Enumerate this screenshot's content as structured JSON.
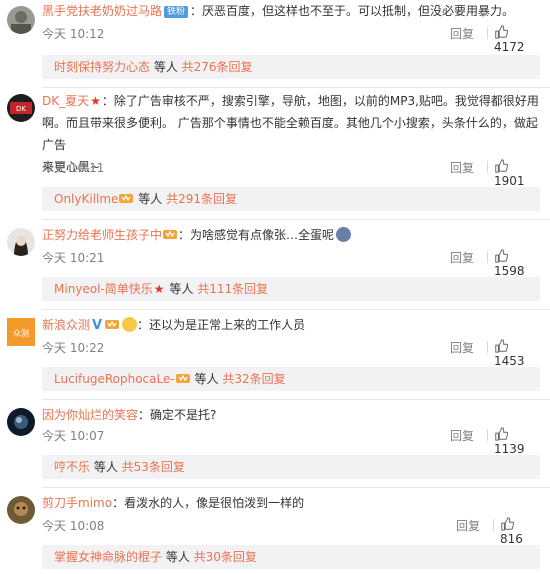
{
  "comments": [
    {
      "username": "黑手党扶老奶奶过马路",
      "badge": "铁粉",
      "text": "：厌恶百度，但这样也不至于。可以抵制，但没必要用暴力。",
      "time": "今天 10:12",
      "reply_label": "回复",
      "likes": "4172",
      "replies": {
        "name": "时刻保持努力心态",
        "mid": " 等人 ",
        "count": "共276条回复"
      }
    },
    {
      "username": "DK_夏天",
      "text_line1": "：除了广告审核不严，搜索引擎，导航，地图，以前的MP3,贴吧。我觉得都很好用",
      "text_line2": "啊。而且带来很多便利。 广告那个事情也不能全赖百度。其他几个小搜索，头条什么的，做起广告",
      "text_line3": "来更心黑~",
      "time": "今天 10:11",
      "reply_label": "回复",
      "likes": "1901",
      "replies": {
        "name": "OnlyKillme",
        "mid": " 等人 ",
        "count": "共291条回复"
      }
    },
    {
      "username": "正努力给老师生孩子中",
      "text": "：为啥感觉有点像张…全蛋呢",
      "time": "今天 10:21",
      "reply_label": "回复",
      "likes": "1598",
      "replies": {
        "name": "Minyeol-简单快乐",
        "mid": " 等人 ",
        "count": "共111条回复"
      }
    },
    {
      "username": "新浪众测",
      "avatar_text": "众测",
      "text": "：还以为是正常上来的工作人员",
      "time": "今天 10:22",
      "reply_label": "回复",
      "likes": "1453",
      "replies": {
        "name": "LucifugeRophocaLe-",
        "mid": " 等人 ",
        "count": "共32条回复"
      }
    },
    {
      "username": "因为你灿烂的笑容",
      "text": "：确定不是托?",
      "time": "今天 10:07",
      "reply_label": "回复",
      "likes": "1139",
      "replies": {
        "name": "哼不乐",
        "mid": " 等人 ",
        "count": "共53条回复"
      }
    },
    {
      "username": "剪刀手mimo",
      "text": "：看泼水的人，像是很怕泼到一样的",
      "time": "今天 10:08",
      "reply_label": "回复",
      "likes": "816",
      "replies": {
        "name": "掌握女神命脉的棍子",
        "mid": " 等人 ",
        "count": "共30条回复"
      }
    }
  ],
  "colors": {
    "username": "#eb7350",
    "badge": "#4f9bde",
    "reply_bg": "#f2f2f5",
    "meta": "#808080"
  },
  "icons": {
    "like": "thumb-up-icon",
    "vip": "vip-crown-icon",
    "star": "red-star-icon",
    "verified": "v-verified-icon"
  }
}
